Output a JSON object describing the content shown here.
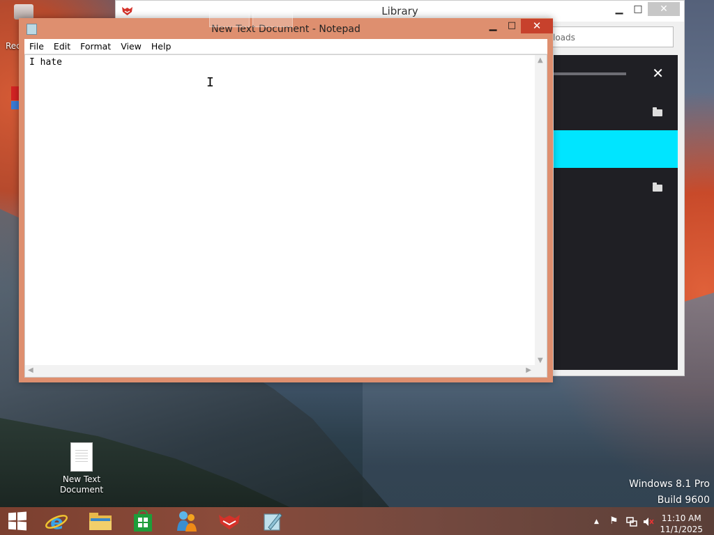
{
  "desktop": {
    "recycle_label": "Rec",
    "file_label_line1": "New Text",
    "file_label_line2": "Document",
    "watermark_line1": "Windows 8.1 Pro",
    "watermark_line2": "Build 9600"
  },
  "library": {
    "title": "Library",
    "minimize": "▁",
    "maximize": "□",
    "close": "✕",
    "search_text": "loads",
    "panel_close": "✕"
  },
  "notepad": {
    "title": "New Text Document - Notepad",
    "minimize": "▁",
    "maximize": "□",
    "close": "✕",
    "menu": [
      "File",
      "Edit",
      "Format",
      "View",
      "Help"
    ],
    "content": "I hate"
  },
  "taskbar": {
    "items": [
      "start-icon",
      "internet-explorer-icon",
      "file-explorer-icon",
      "store-icon",
      "messenger-icon",
      "firefox-icon",
      "notepad-icon"
    ],
    "active_item": "notepad-icon",
    "clock_time": "11:10 AM",
    "clock_date": "11/1/2025",
    "tray_up_arrow": "▲",
    "tray_flag": "⚑"
  },
  "colors": {
    "notepad_frame": "#de8f6f",
    "notepad_close": "#c7412c",
    "library_highlight": "#00e5ff",
    "taskbar": "#7b3f2f"
  }
}
